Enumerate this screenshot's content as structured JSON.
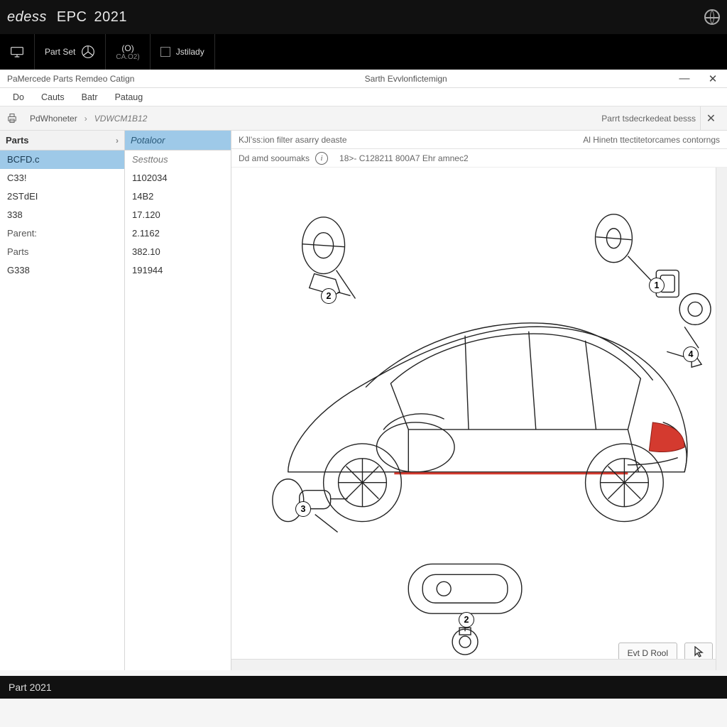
{
  "appbar": {
    "brand": "edess",
    "product": "EPC",
    "year": "2021"
  },
  "toolbar": {
    "btn_monitor": {
      "label": ""
    },
    "btn_partset": {
      "label": "Part Set"
    },
    "btn_cat": {
      "label": "(O)",
      "sub": "CA.O2)"
    },
    "btn_check": {
      "label": "Jstilady"
    }
  },
  "win": {
    "title_left": "PaMercede Parts Remdeo Catign",
    "title_center": "Sarth Evvlonfictemign"
  },
  "menubar": {
    "items": [
      "Do",
      "Cauts",
      "Batr",
      "Pataug"
    ]
  },
  "crumb": {
    "label": "PdWhoneter",
    "vin": "VDWCM1B12",
    "right_text": "Parrt tsdecrkedeat besss"
  },
  "col1": {
    "header": "Parts",
    "items": [
      {
        "text": "BCFD.c",
        "sel": true
      },
      {
        "text": "C33!"
      },
      {
        "text": "2STdEI"
      },
      {
        "text": "338"
      },
      {
        "text": "Parent:",
        "lbl": true
      },
      {
        "text": "Parts",
        "lbl": true
      },
      {
        "text": "G338"
      }
    ]
  },
  "col2": {
    "header": "Potaloor",
    "items": [
      {
        "text": "Sesttous",
        "muted": true
      },
      {
        "text": "1102034"
      },
      {
        "text": "14B2"
      },
      {
        "text": "17.120"
      },
      {
        "text": "2.1162"
      },
      {
        "text": "382.10"
      },
      {
        "text": "191944"
      }
    ]
  },
  "diagram": {
    "title": "KJl’ss:ion filter asarry deaste",
    "sub": "Dd amd sooumaks",
    "right_top": "Al Hinetn ttectitetorcames contorngs",
    "right_sub": "18>- C128211 800A7 Ehr amnec2",
    "button_label": "Evt D Rool"
  },
  "callouts": {
    "c1": "1",
    "c2": "2",
    "c3": "3",
    "c4": "4",
    "c5": "2"
  },
  "footer": {
    "text": "Part 2021"
  }
}
